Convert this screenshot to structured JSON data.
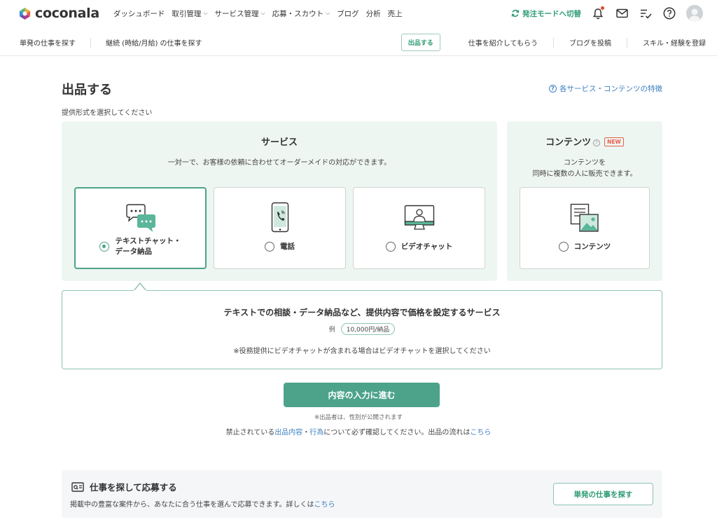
{
  "header": {
    "logo_text": "coconala",
    "nav": [
      {
        "label": "ダッシュボード",
        "has_dropdown": false
      },
      {
        "label": "取引管理",
        "has_dropdown": true
      },
      {
        "label": "サービス管理",
        "has_dropdown": true
      },
      {
        "label": "応募・スカウト",
        "has_dropdown": true
      },
      {
        "label": "ブログ",
        "has_dropdown": false
      },
      {
        "label": "分析",
        "has_dropdown": false
      },
      {
        "label": "売上",
        "has_dropdown": false
      }
    ],
    "switch_mode_label": "発注モードへ切替",
    "icons": [
      "bell-icon",
      "mail-icon",
      "checklist-icon",
      "help-icon",
      "avatar"
    ],
    "accent_color": "#2e9c74"
  },
  "subheader": {
    "left_links": [
      "単発の仕事を探す",
      "継続 (時給/月給) の仕事を探す"
    ],
    "listing_button": "出品する",
    "right_links": [
      "仕事を紹介してもらう",
      "ブログを投稿",
      "スキル・経験を登録"
    ]
  },
  "main": {
    "title": "出品する",
    "help_link": "各サービス・コンテンツの特徴",
    "select_hint": "提供形式を選択してください",
    "service": {
      "title": "サービス",
      "description": "一対一で、お客様の依頼に合わせてオーダーメイドの対応ができます。",
      "options": [
        {
          "label_line1": "テキストチャット・",
          "label_line2": "データ納品",
          "icon": "chat-bubbles-icon",
          "selected": true
        },
        {
          "label_line1": "電話",
          "icon": "phone-icon",
          "selected": false
        },
        {
          "label_line1": "ビデオチャット",
          "icon": "video-monitor-icon",
          "selected": false
        }
      ]
    },
    "content": {
      "title": "コンテンツ",
      "badge": "NEW",
      "description_line1": "コンテンツを",
      "description_line2": "同時に複数の人に販売できます。",
      "option": {
        "label": "コンテンツ",
        "icon": "document-image-icon",
        "selected": false
      }
    },
    "detail": {
      "title": "テキストでの相談・データ納品など、提供内容で価格を設定するサービス",
      "example_label": "例",
      "example_price": "10,000円/納品",
      "note": "※役務提供にビデオチャットが含まれる場合はビデオチャットを選択してください"
    },
    "cta": {
      "label": "内容の入力に進む",
      "note": "※出品者は、性別が公開されます",
      "rule_prefix": "禁止されている",
      "rule_link1": "出品内容",
      "rule_sep": "・",
      "rule_link2": "行為",
      "rule_middle": "について必ず確認してください。出品の流れは",
      "rule_link3": "こちら"
    }
  },
  "bottom": {
    "title": "仕事を探して応募する",
    "description": "掲載中の豊富な案件から、あなたに合う仕事を選んで応募できます。詳しくは",
    "description_link": "こちら",
    "button": "単発の仕事を探す"
  }
}
